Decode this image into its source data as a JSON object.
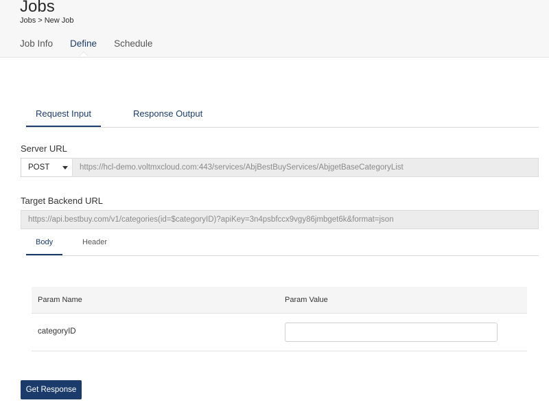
{
  "header": {
    "title": "Jobs",
    "breadcrumb": {
      "parent": "Jobs",
      "separator": ">",
      "current": "New Job"
    },
    "tabs": [
      {
        "label": "Job Info"
      },
      {
        "label": "Define"
      },
      {
        "label": "Schedule"
      }
    ],
    "active_tab": "Define"
  },
  "request_tabs": [
    {
      "label": "Request Input"
    },
    {
      "label": "Response Output"
    }
  ],
  "active_request_tab": "Request Input",
  "server_url": {
    "label": "Server URL",
    "method": "POST",
    "value": "https://hcl-demo.voltmxcloud.com:443/services/AbjBestBuyServices/AbjgetBaseCategoryList"
  },
  "target_backend": {
    "label": "Target Backend URL",
    "value": "https://api.bestbuy.com/v1/categories(id=$categoryID)?apiKey=3n4psbfccx9vgy86jmbget6k&format=json"
  },
  "body_tabs": [
    {
      "label": "Body"
    },
    {
      "label": "Header"
    }
  ],
  "active_body_tab": "Body",
  "params": {
    "headers": [
      "Param Name",
      "Param Value"
    ],
    "rows": [
      {
        "name": "categoryID",
        "value": ""
      }
    ]
  },
  "actions": {
    "get_response_label": "Get Response"
  },
  "colors": {
    "accent": "#1b3c6b",
    "header_bg": "#f7f7f7",
    "readonly_bg": "#ececec"
  },
  "icons": {
    "method_dropdown": "chevron-down-icon",
    "active_tab_marker": "caret-up-icon"
  }
}
